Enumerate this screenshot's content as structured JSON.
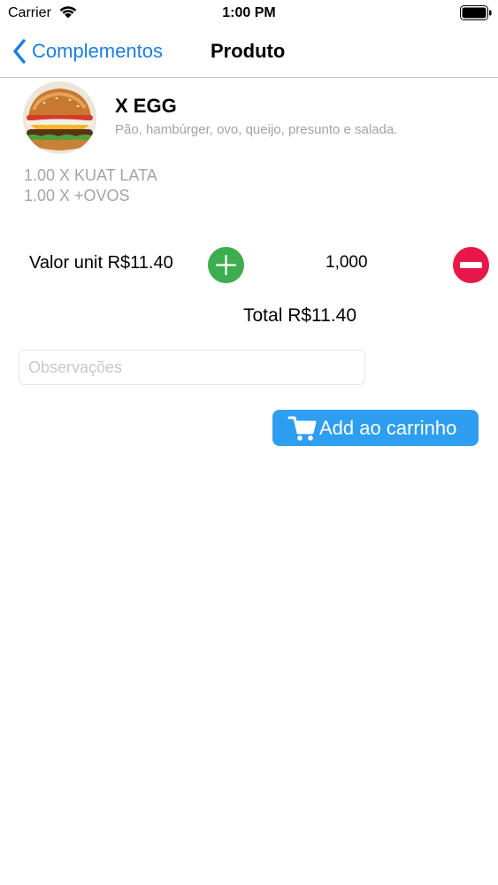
{
  "status": {
    "carrier": "Carrier",
    "time": "1:00 PM"
  },
  "nav": {
    "back_label": "Complementos",
    "title": "Produto"
  },
  "product": {
    "name": "X EGG",
    "description": "Pão, hambúrger, ovo, queijo, presunto e salada.",
    "image_icon": "burger-image"
  },
  "addons": [
    "1.00 X KUAT LATA",
    "1.00 X +OVOS"
  ],
  "quantity": {
    "unit_label": "Valor unit R$11.40",
    "value": "1,000",
    "increment_icon": "plus-icon",
    "decrement_icon": "minus-icon"
  },
  "total_label": "Total R$11.40",
  "notes": {
    "placeholder": "Observações",
    "value": ""
  },
  "cart_button": {
    "label": "Add ao carrinho",
    "icon": "cart-icon"
  },
  "colors": {
    "accent": "#1a7ee8",
    "plus": "#3ead4f",
    "minus": "#e8174a",
    "cart_button": "#2d9ef0",
    "muted_text": "#a3a3a8"
  }
}
